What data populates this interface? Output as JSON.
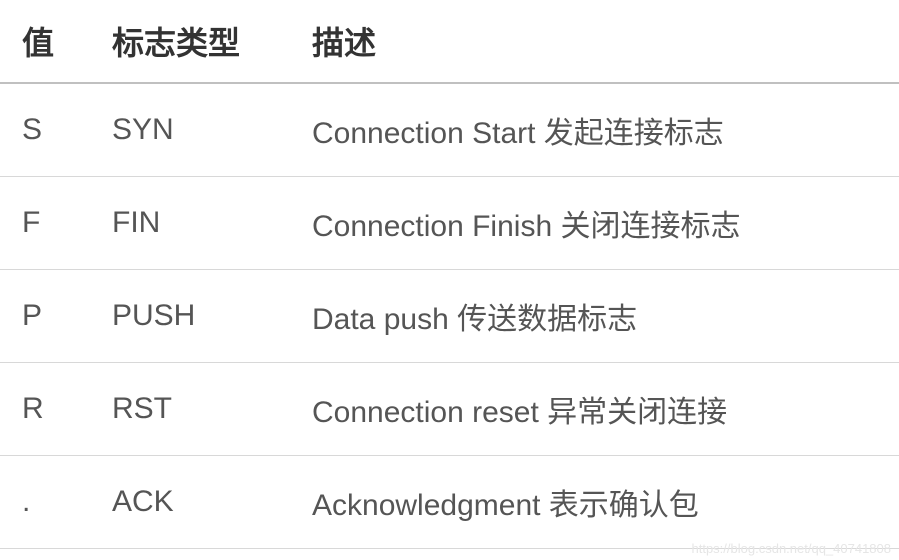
{
  "table": {
    "headers": {
      "value": "值",
      "flag_type": "标志类型",
      "description": "描述"
    },
    "rows": [
      {
        "value": "S",
        "flag_type": "SYN",
        "description": "Connection Start 发起连接标志"
      },
      {
        "value": "F",
        "flag_type": "FIN",
        "description": "Connection Finish 关闭连接标志"
      },
      {
        "value": "P",
        "flag_type": "PUSH",
        "description": "Data push 传送数据标志"
      },
      {
        "value": "R",
        "flag_type": "RST",
        "description": "Connection reset 异常关闭连接"
      },
      {
        "value": ".",
        "flag_type": "ACK",
        "description": "Acknowledgment 表示确认包"
      }
    ]
  },
  "watermark": "https://blog.csdn.net/qq_40741808"
}
